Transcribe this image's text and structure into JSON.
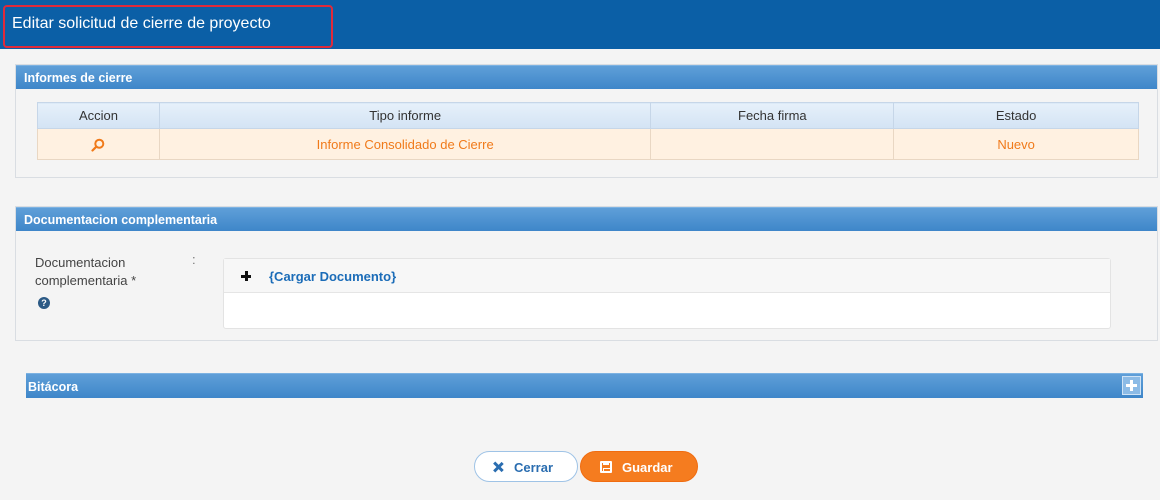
{
  "window": {
    "title": "Editar solicitud de cierre de proyecto"
  },
  "informes": {
    "header": "Informes de cierre",
    "columns": [
      "Accion",
      "Tipo informe",
      "Fecha firma",
      "Estado"
    ],
    "rows": [
      {
        "action_icon": "search-icon",
        "tipo": "Informe Consolidado de Cierre",
        "fecha": "",
        "estado": "Nuevo"
      }
    ]
  },
  "documentacion": {
    "header": "Documentacion complementaria",
    "field_label_1": "Documentacion",
    "field_label_2": "complementaria *",
    "colon": ":",
    "help_icon": "?",
    "upload_link": "{Cargar Documento}"
  },
  "bitacora": {
    "header": "Bitácora"
  },
  "buttons": {
    "cerrar": "Cerrar",
    "guardar": "Guardar"
  },
  "colors": {
    "titlebar": "#0b5fa6",
    "panel_header": "#4a8fd0",
    "row_highlight": "#fff1e1",
    "row_text": "#f07a1a",
    "primary_button": "#f57c1f"
  }
}
